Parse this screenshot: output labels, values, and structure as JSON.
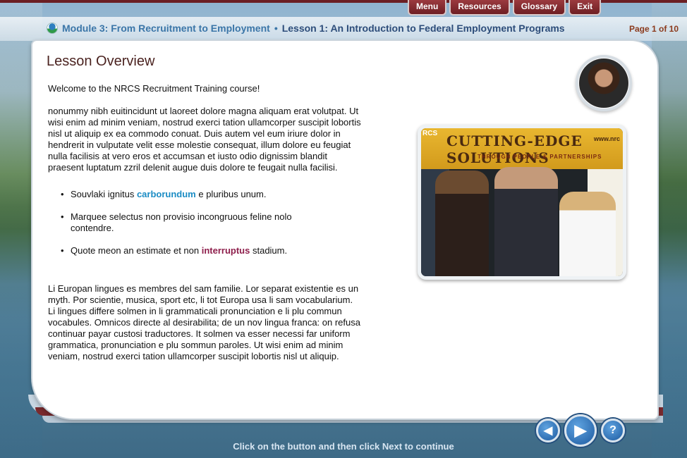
{
  "nav": {
    "menu": "Menu",
    "resources": "Resources",
    "glossary": "Glossary",
    "exit": "Exit"
  },
  "header": {
    "module": "Module 3: From Recruitment to Employment",
    "separator": "•",
    "lesson": "Lesson 1: An Introduction to Federal Employment Programs",
    "page": "Page 1 of 10"
  },
  "main": {
    "heading": "Lesson Overview",
    "welcome": "Welcome to the NRCS Recruitment Training course!",
    "para1": "nonummy nibh euitincidunt ut laoreet dolore magna aliquam erat volutpat. Ut wisi enim ad minim veniam, nostrud exerci tation ullamcorper suscipit lobortis nisl ut aliquip ex ea commodo conuat. Duis autem vel eum iriure dolor in hendrerit in vulputate velit esse molestie consequat, illum dolore eu feugiat nulla facilisis at vero eros et accumsan et iusto odio dignissim blandit praesent luptatum zzril delenit augue duis dolore te feugait nulla facilisi.",
    "bullets": [
      {
        "before": "Souvlaki ignitus ",
        "highlight": "carborundum",
        "after": " e pluribus unum."
      },
      {
        "before": "Marquee selectus non provisio incongruous feline nolo contendre.",
        "highlight": "",
        "after": ""
      },
      {
        "before": "Quote meon an estimate et non ",
        "highlight": "interruptus",
        "after": " stadium."
      }
    ],
    "para2": "Li Europan lingues es membres del sam familie. Lor separat existentie es un myth. Por scientie, musica, sport etc, li tot Europa usa li sam vocabularium. Li lingues differe solmen in li grammaticali pronunciation e li plu commun vocabules. Omnicos directe al desirabilita; de un nov lingua franca: on refusa continuar payar custosi traductores. It solmen va esser necessi far uniform grammatica, pronunciation e plu sommun paroles. Ut wisi enim ad minim veniam, nostrud exerci tation ullamcorper suscipit lobortis nisl ut aliquip."
  },
  "photo": {
    "banner_title": "CUTTING-EDGE SOLUTIONS",
    "banner_sub": "THROUGH PEOPLE & PARTNERSHIPS",
    "banner_left": "RCS",
    "banner_right": "www.nrc"
  },
  "footer": {
    "back_icon": "◀",
    "next_icon": "▶",
    "help_icon": "?",
    "instruction": "Click on the button and then click Next to continue"
  }
}
